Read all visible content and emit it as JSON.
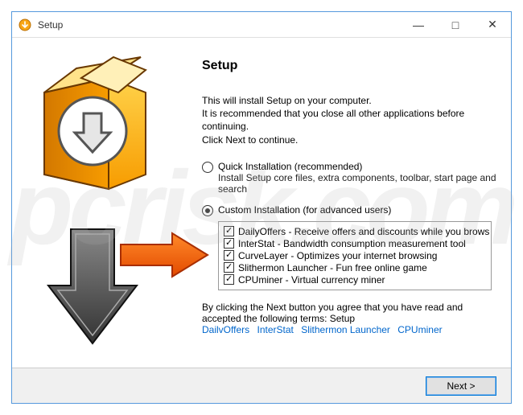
{
  "window": {
    "title": "Setup",
    "controls": {
      "min": "—",
      "max": "□",
      "close": "✕"
    }
  },
  "heading": "Setup",
  "intro": {
    "line1": "This will install Setup on your computer.",
    "line2": "It is recommended that you close all other applications before continuing.",
    "line3": "Click Next to continue."
  },
  "options": {
    "quick": {
      "label": "Quick Installation (recommended)",
      "desc": "Install Setup core files, extra components, toolbar, start page and search",
      "selected": false
    },
    "custom": {
      "label": "Custom Installation (for advanced users)",
      "selected": true
    }
  },
  "components": [
    {
      "label": "DailyOffers - Receive offers and discounts while you brows",
      "checked": true
    },
    {
      "label": "InterStat - Bandwidth consumption measurement tool",
      "checked": true
    },
    {
      "label": "CurveLayer - Optimizes your internet browsing",
      "checked": true
    },
    {
      "label": "Slithermon Launcher - Fun free online game",
      "checked": true
    },
    {
      "label": "CPUminer - Virtual currency miner",
      "checked": true
    }
  ],
  "terms": {
    "text1": "By clicking the Next button you agree that you have read and",
    "text2": "accepted the following terms: Setup",
    "links": [
      "DailvOffers",
      "InterStat",
      "Slithermon Launcher",
      "CPUminer"
    ]
  },
  "footer": {
    "next": "Next >"
  },
  "watermark": "pcrisk.com"
}
